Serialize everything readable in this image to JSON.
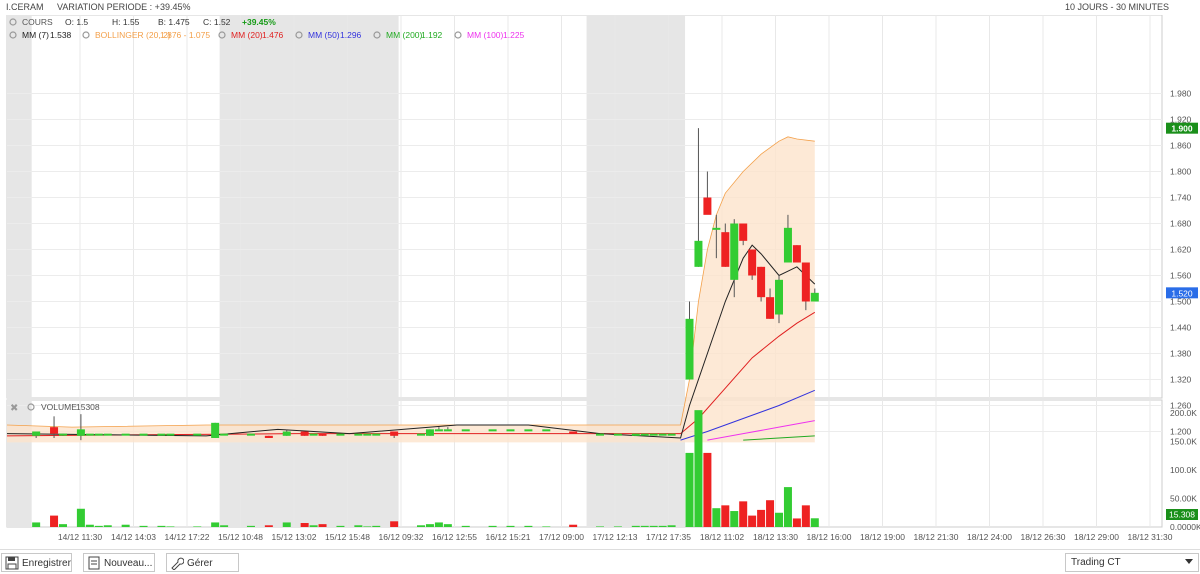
{
  "header": {
    "symbol": "I.CERAM",
    "variation": "VARIATION PERIODE : +39.45%",
    "period": "10 JOURS - 30 MINUTES"
  },
  "legend": {
    "cours": "COURS",
    "o": "O: 1.5",
    "h": "H: 1.55",
    "b": "B: 1.475",
    "c": "C: 1.52",
    "chg": "+39.45%",
    "mm7": "MM (7)",
    "mm7_val": "1.538",
    "boll": "BOLLINGER (20, 2)",
    "boll_val": "1.876 - 1.075",
    "mm20": "MM (20)",
    "mm20_val": "1.476",
    "mm50": "MM (50)",
    "mm50_val": "1.296",
    "mm200": "MM (200)",
    "mm200_val": "1.192",
    "mm100": "MM (100)",
    "mm100_val": "1.225"
  },
  "volume_legend": {
    "label": "VOLUME",
    "value": "15308"
  },
  "colors": {
    "up": "#33cc33",
    "down": "#ee2222",
    "bollinger": "#f3a04a",
    "mm7": "#222222",
    "mm20": "#e02020",
    "mm50": "#3333dd",
    "mm200": "#22aa22",
    "mm100": "#ee33ee",
    "up_chg": "#159a15"
  },
  "price_badges": {
    "high": "1.900",
    "last": "1.520"
  },
  "volume_badge": "15.308",
  "chart_data": {
    "type": "candlestick",
    "price_ylim": [
      1.18,
      2.02
    ],
    "price_ticks": [
      "1.980",
      "1.920",
      "1.860",
      "1.800",
      "1.740",
      "1.680",
      "1.620",
      "1.560",
      "1.500",
      "1.440",
      "1.380",
      "1.320",
      "1.260",
      "1.200"
    ],
    "volume_ylim": [
      0,
      215000
    ],
    "volume_ticks": [
      "200.0K",
      "150.0K",
      "100.0K",
      "50.00K",
      "0.0000K"
    ],
    "x_labels": [
      "14/12 11:30",
      "14/12 14:03",
      "14/12 17:22",
      "15/12 10:48",
      "15/12 13:02",
      "15/12 15:48",
      "16/12 09:32",
      "16/12 12:55",
      "16/12 15:21",
      "17/12 09:00",
      "17/12 12:13",
      "17/12 17:35",
      "18/12 11:02",
      "18/12 13:30",
      "18/12 16:00",
      "18/12 19:00",
      "18/12 21:30",
      "18/12 24:00",
      "18/12 26:30",
      "18/12 29:00",
      "18/12 31:30"
    ],
    "sessions_shaded": [
      [
        0,
        0.5
      ],
      [
        21.5,
        41.5
      ],
      [
        62.5,
        73.5
      ]
    ],
    "candles": [
      [
        1,
        1.19,
        1.2,
        1.185,
        1.2,
        8000
      ],
      [
        3,
        1.21,
        1.235,
        1.185,
        1.195,
        20000
      ],
      [
        4,
        1.195,
        1.195,
        1.19,
        1.195,
        5000
      ],
      [
        6,
        1.19,
        1.24,
        1.18,
        1.205,
        32000
      ],
      [
        7,
        1.195,
        1.195,
        1.195,
        1.195,
        4000
      ],
      [
        8,
        1.195,
        1.195,
        1.195,
        1.195,
        2000
      ],
      [
        9,
        1.195,
        1.195,
        1.195,
        1.195,
        3000
      ],
      [
        11,
        1.195,
        1.195,
        1.195,
        1.195,
        4000
      ],
      [
        13,
        1.195,
        1.195,
        1.195,
        1.195,
        2000
      ],
      [
        15,
        1.195,
        1.195,
        1.195,
        1.195,
        2000
      ],
      [
        16,
        1.195,
        1.195,
        1.195,
        1.195,
        1000
      ],
      [
        19,
        1.195,
        1.195,
        1.195,
        1.195,
        1000
      ],
      [
        21,
        1.185,
        1.22,
        1.185,
        1.22,
        8000
      ],
      [
        22,
        1.195,
        1.195,
        1.195,
        1.195,
        3000
      ],
      [
        25,
        1.195,
        1.195,
        1.195,
        1.195,
        2000
      ],
      [
        27,
        1.19,
        1.19,
        1.185,
        1.185,
        3000
      ],
      [
        29,
        1.19,
        1.205,
        1.19,
        1.2,
        8000
      ],
      [
        31,
        1.2,
        1.2,
        1.19,
        1.19,
        7000
      ],
      [
        32,
        1.195,
        1.195,
        1.195,
        1.195,
        3000
      ],
      [
        33,
        1.195,
        1.195,
        1.19,
        1.19,
        5000
      ],
      [
        35,
        1.195,
        1.195,
        1.195,
        1.195,
        2000
      ],
      [
        37,
        1.195,
        1.195,
        1.195,
        1.195,
        3000
      ],
      [
        38,
        1.195,
        1.195,
        1.195,
        1.195,
        1000
      ],
      [
        39,
        1.195,
        1.195,
        1.195,
        1.195,
        2000
      ],
      [
        41,
        1.2,
        1.2,
        1.185,
        1.19,
        10000
      ],
      [
        44,
        1.195,
        1.195,
        1.195,
        1.195,
        3000
      ],
      [
        45,
        1.19,
        1.205,
        1.19,
        1.205,
        5000
      ],
      [
        46,
        1.205,
        1.21,
        1.205,
        1.205,
        8000
      ],
      [
        47,
        1.205,
        1.21,
        1.205,
        1.205,
        5000
      ],
      [
        49,
        1.205,
        1.205,
        1.205,
        1.205,
        2000
      ],
      [
        52,
        1.205,
        1.205,
        1.205,
        1.205,
        2000
      ],
      [
        54,
        1.205,
        1.205,
        1.205,
        1.205,
        2000
      ],
      [
        56,
        1.205,
        1.205,
        1.205,
        1.205,
        2000
      ],
      [
        58,
        1.205,
        1.205,
        1.205,
        1.205,
        1000
      ],
      [
        61,
        1.2,
        1.2,
        1.195,
        1.195,
        4000
      ],
      [
        64,
        1.195,
        1.195,
        1.195,
        1.195,
        1000
      ],
      [
        66,
        1.195,
        1.195,
        1.195,
        1.195,
        1000
      ],
      [
        68,
        1.19,
        1.195,
        1.19,
        1.195,
        2000
      ],
      [
        69,
        1.195,
        1.195,
        1.195,
        1.195,
        2000
      ],
      [
        70,
        1.195,
        1.195,
        1.195,
        1.195,
        2000
      ],
      [
        71,
        1.195,
        1.195,
        1.195,
        1.195,
        2000
      ],
      [
        72,
        1.195,
        1.195,
        1.195,
        1.195,
        3000
      ],
      [
        74,
        1.32,
        1.5,
        1.32,
        1.46,
        130000
      ],
      [
        75,
        1.58,
        1.9,
        1.58,
        1.64,
        205000
      ],
      [
        76,
        1.74,
        1.8,
        1.71,
        1.7,
        130000
      ],
      [
        77,
        1.67,
        1.7,
        1.6,
        1.67,
        33000
      ],
      [
        78,
        1.66,
        1.68,
        1.58,
        1.58,
        38000
      ],
      [
        79,
        1.55,
        1.69,
        1.51,
        1.68,
        28000
      ],
      [
        80,
        1.68,
        1.68,
        1.63,
        1.64,
        45000
      ],
      [
        81,
        1.62,
        1.62,
        1.55,
        1.56,
        20000
      ],
      [
        82,
        1.58,
        1.58,
        1.5,
        1.51,
        30000
      ],
      [
        83,
        1.51,
        1.53,
        1.46,
        1.46,
        47000
      ],
      [
        84,
        1.47,
        1.56,
        1.45,
        1.55,
        25000
      ],
      [
        85,
        1.59,
        1.7,
        1.59,
        1.67,
        70000
      ],
      [
        86,
        1.63,
        1.63,
        1.59,
        1.59,
        15000
      ],
      [
        87,
        1.59,
        1.59,
        1.48,
        1.5,
        38000
      ],
      [
        88,
        1.5,
        1.53,
        1.5,
        1.52,
        15308
      ]
    ],
    "mm7": [
      [
        0,
        1.195
      ],
      [
        20,
        1.19
      ],
      [
        28,
        1.205
      ],
      [
        36,
        1.195
      ],
      [
        48,
        1.215
      ],
      [
        56,
        1.215
      ],
      [
        64,
        1.195
      ],
      [
        73,
        1.185
      ],
      [
        74,
        1.26
      ],
      [
        76,
        1.38
      ],
      [
        78,
        1.5
      ],
      [
        80,
        1.6
      ],
      [
        81,
        1.63
      ],
      [
        82,
        1.61
      ],
      [
        84,
        1.56
      ],
      [
        85,
        1.57
      ],
      [
        86,
        1.58
      ],
      [
        88,
        1.54
      ]
    ],
    "mm20": [
      [
        0,
        1.19
      ],
      [
        30,
        1.195
      ],
      [
        60,
        1.195
      ],
      [
        73,
        1.195
      ],
      [
        75,
        1.23
      ],
      [
        78,
        1.3
      ],
      [
        81,
        1.37
      ],
      [
        84,
        1.42
      ],
      [
        86,
        1.45
      ],
      [
        88,
        1.475
      ]
    ],
    "mm50": [
      [
        73,
        1.18
      ],
      [
        76,
        1.2
      ],
      [
        80,
        1.23
      ],
      [
        84,
        1.26
      ],
      [
        88,
        1.295
      ]
    ],
    "mm100": [
      [
        76,
        1.18
      ],
      [
        80,
        1.195
      ],
      [
        84,
        1.21
      ],
      [
        88,
        1.225
      ]
    ],
    "mm200": [
      [
        80,
        1.18
      ],
      [
        84,
        1.185
      ],
      [
        88,
        1.19
      ]
    ],
    "boll_upper": [
      [
        0,
        1.215
      ],
      [
        5,
        1.21
      ],
      [
        20,
        1.215
      ],
      [
        40,
        1.215
      ],
      [
        60,
        1.215
      ],
      [
        72,
        1.215
      ],
      [
        73,
        1.215
      ],
      [
        74,
        1.32
      ],
      [
        75,
        1.5
      ],
      [
        76,
        1.62
      ],
      [
        77,
        1.7
      ],
      [
        78,
        1.75
      ],
      [
        80,
        1.8
      ],
      [
        82,
        1.84
      ],
      [
        84,
        1.87
      ],
      [
        85,
        1.88
      ],
      [
        86,
        1.875
      ],
      [
        88,
        1.87
      ]
    ],
    "boll_lower": [
      [
        0,
        1.175
      ],
      [
        20,
        1.175
      ],
      [
        40,
        1.175
      ],
      [
        60,
        1.175
      ],
      [
        73,
        1.175
      ],
      [
        88,
        1.175
      ]
    ]
  },
  "toolbar": {
    "save": "Enregistrer",
    "new": "Nouveau...",
    "manage": "Gérer",
    "mode": "Trading CT"
  }
}
